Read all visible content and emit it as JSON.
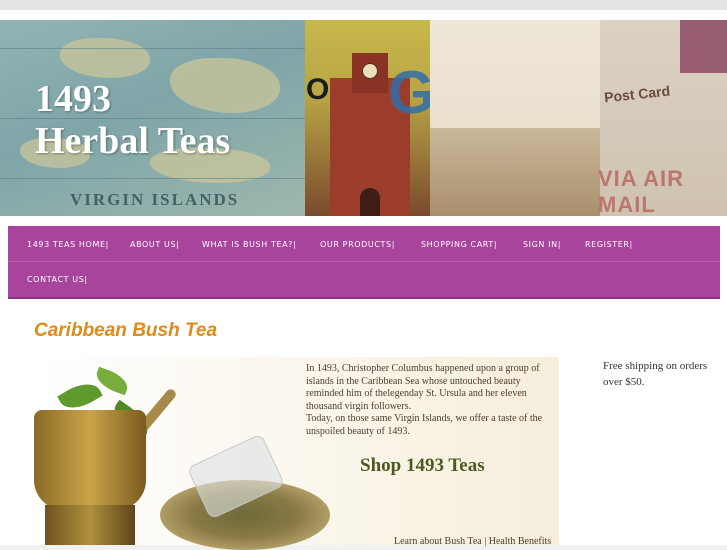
{
  "site": {
    "title_line1": "1493",
    "title_line2": "Herbal Teas"
  },
  "banner": {
    "map_label": "VIRGIN ISLANDS",
    "postcard_word": "Post Card",
    "airmail": "VIA AIR MAIL",
    "only_text": "ONLY",
    "letter_g": "G"
  },
  "nav": {
    "items": [
      {
        "label": "1493 TEAS HOME|"
      },
      {
        "label": "ABOUT US|"
      },
      {
        "label": "WHAT IS BUSH TEA?|"
      },
      {
        "label": "OUR PRODUCTS|"
      },
      {
        "label": "SHOPPING CART|"
      },
      {
        "label": "SIGN IN|"
      },
      {
        "label": "REGISTER|"
      },
      {
        "label": "CONTACT US|"
      }
    ]
  },
  "main": {
    "heading": "Caribbean Bush Tea",
    "promo": {
      "paragraph1": "In 1493, Christopher Columbus happened upon a group of islands in the Caribbean Sea whose untouched beauty reminded him of thelegenday St. Ursula and her eleven thousand virgin followers.",
      "paragraph2": "Today, on those same Virgin Islands, we offer a taste of the unspoiled beauty of 1493.",
      "shop_label": "Shop 1493 Teas",
      "learn_label": "Learn about Bush Tea",
      "separator": " | ",
      "health_label": "Health Benefits"
    }
  },
  "sidebar": {
    "shipping_text": "Free shipping on orders over $50."
  },
  "colors": {
    "nav_bg": "#a8449c",
    "heading": "#e08a17",
    "shop_link": "#4c5a1e",
    "title": "#ffffff"
  }
}
